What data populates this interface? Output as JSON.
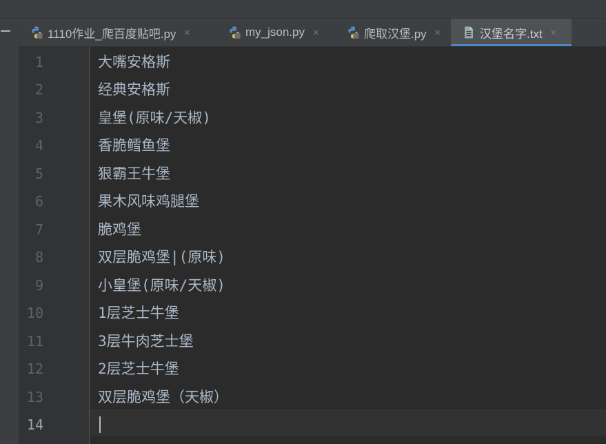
{
  "tabs": [
    {
      "label": "1110作业_爬百度贴吧.py",
      "icon": "python-file-icon",
      "active": false
    },
    {
      "label": "my_json.py",
      "icon": "python-file-icon",
      "active": false
    },
    {
      "label": "爬取汉堡.py",
      "icon": "python-file-icon",
      "active": false
    },
    {
      "label": "汉堡名字.txt",
      "icon": "text-file-icon",
      "active": true
    }
  ],
  "close_glyph": "×",
  "editor": {
    "current_line": 14,
    "lines": [
      {
        "number": "1",
        "text": "大嘴安格斯"
      },
      {
        "number": "2",
        "text": "经典安格斯"
      },
      {
        "number": "3",
        "text": "皇堡(原味/天椒)"
      },
      {
        "number": "4",
        "text": "香脆鳕鱼堡"
      },
      {
        "number": "5",
        "text": "狠霸王牛堡"
      },
      {
        "number": "6",
        "text": "果木风味鸡腿堡"
      },
      {
        "number": "7",
        "text": "脆鸡堡"
      },
      {
        "number": "8",
        "text": "双层脆鸡堡|(原味)"
      },
      {
        "number": "9",
        "text": "小皇堡(原味/天椒)"
      },
      {
        "number": "10",
        "text": "1层芝士牛堡"
      },
      {
        "number": "11",
        "text": "3层牛肉芝士堡"
      },
      {
        "number": "12",
        "text": "2层芝士牛堡"
      },
      {
        "number": "13",
        "text": "双层脆鸡堡（天椒）"
      },
      {
        "number": "14",
        "text": ""
      }
    ]
  },
  "colors": {
    "background": "#2b2b2b",
    "gutter": "#313335",
    "text": "#a9b7c6",
    "line_number": "#606366",
    "active_tab_underline": "#4a88c7"
  }
}
